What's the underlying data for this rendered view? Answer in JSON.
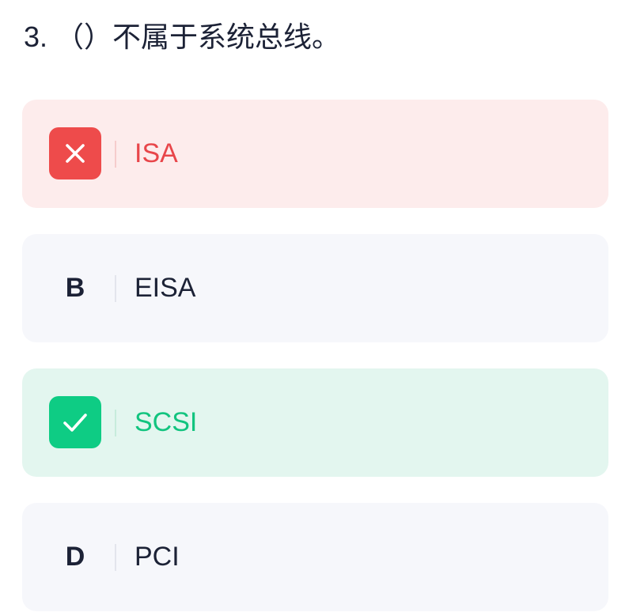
{
  "question": {
    "text": "3. （）不属于系统总线。"
  },
  "options": [
    {
      "marker": "",
      "marker_icon": "close-icon",
      "text": "ISA",
      "state": "wrong"
    },
    {
      "marker": "B",
      "text": "EISA",
      "state": "neutral"
    },
    {
      "marker": "",
      "marker_icon": "check-icon",
      "text": "SCSI",
      "state": "correct"
    },
    {
      "marker": "D",
      "text": "PCI",
      "state": "neutral"
    }
  ],
  "colors": {
    "wrong_bg": "#fdecec",
    "wrong_accent": "#ee4b4b",
    "correct_bg": "#e3f6ef",
    "correct_accent": "#0ecc84",
    "neutral_bg": "#f6f7fb",
    "text": "#1c2236"
  }
}
